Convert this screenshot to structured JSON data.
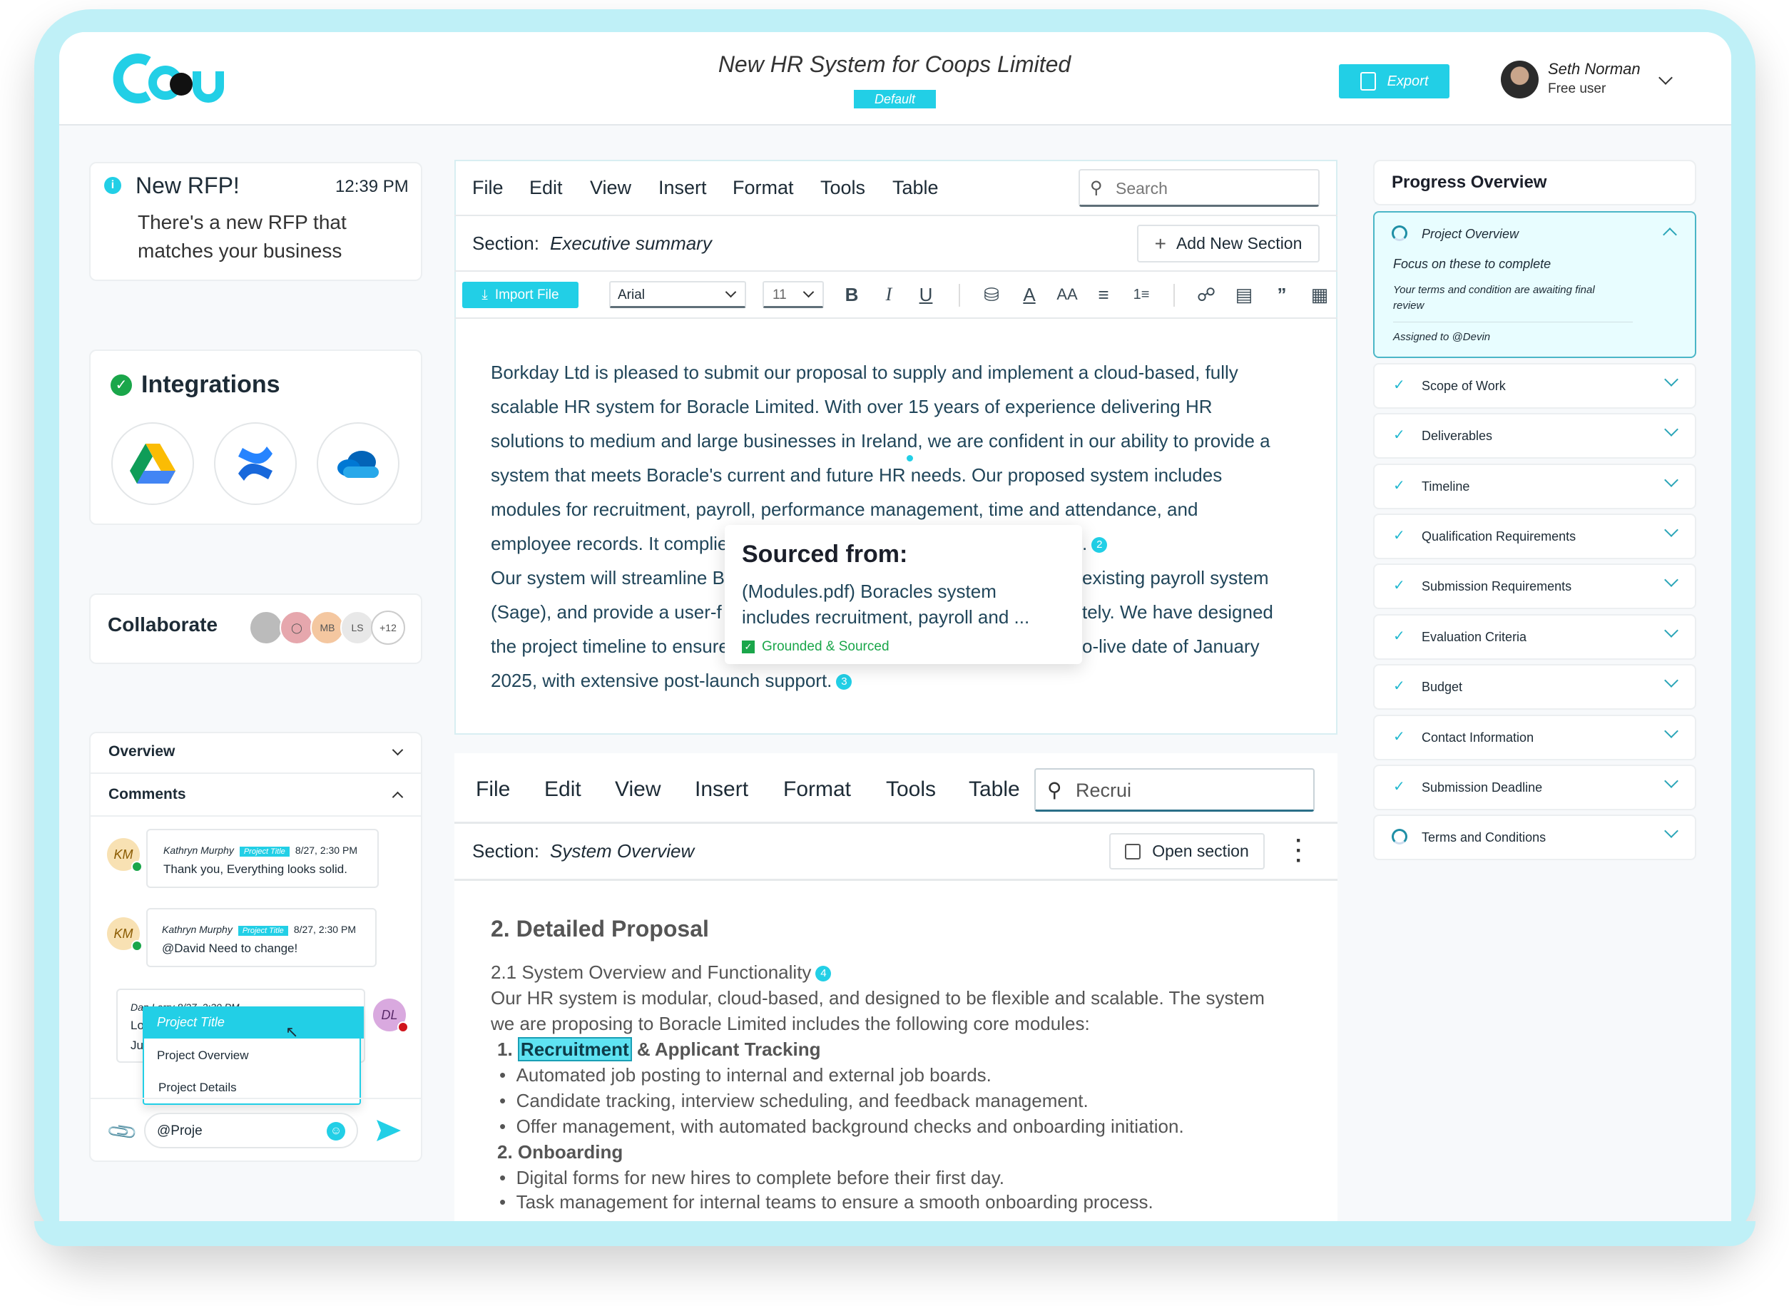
{
  "header": {
    "title": "New HR System for Coops Limited",
    "badge": "Default",
    "export_label": "Export",
    "user_name": "Seth Norman",
    "user_plan": "Free user"
  },
  "notification": {
    "title": "New RFP!",
    "time": "12:39 PM",
    "message_line1": "There's a new RFP that",
    "message_line2": "matches your business"
  },
  "integrations": {
    "title": "Integrations",
    "items": [
      "google-drive",
      "confluence",
      "onedrive"
    ]
  },
  "collaborate": {
    "title": "Collaborate",
    "avatars": [
      "MB",
      "LS",
      "+12"
    ]
  },
  "sidebar": {
    "overview_label": "Overview",
    "comments_label": "Comments"
  },
  "comments": [
    {
      "initials": "KM",
      "author": "Kathryn Murphy",
      "tag": "Project Title",
      "time": "8/27, 2:30 PM",
      "text": "Thank you, Everything looks solid."
    },
    {
      "initials": "KM",
      "author": "Kathryn Murphy",
      "tag": "Project Title",
      "time": "8/27, 2:30 PM",
      "text": "@David Need to change!"
    },
    {
      "initials": "DL",
      "author_partial": "Dan Larry  8/27, 2:30 PM",
      "line2": "Lo",
      "line3": "Ju"
    }
  ],
  "mention_dropdown": {
    "options": [
      "Project Title",
      "Project Overview",
      "Project Details"
    ],
    "selected": "Project Title"
  },
  "comment_input": {
    "value": "@Proje"
  },
  "editor1": {
    "menu": [
      "File",
      "Edit",
      "View",
      "Insert",
      "Format",
      "Tools",
      "Table"
    ],
    "search_placeholder": "Search",
    "section_label": "Section:",
    "section_name": "Executive summary",
    "add_section_label": "Add New Section",
    "import_label": "Import File",
    "font": "Arial",
    "font_size": "11",
    "lines": [
      "Borkday Ltd is pleased to submit our proposal to supply and implement a cloud-based, fully",
      "scalable HR system for Boracle Limited. With over 15 years of experience delivering HR",
      "solutions to medium and large businesses in Ireland, we are confident in our ability to provide a",
      "system that meets Boracle's current and future HR needs. Our proposed system includes",
      "modules for recruitment, payroll, performance management, time and attendance, and"
    ],
    "occluded_lines": [
      {
        "left": "employee records. It complie",
        "right": "."
      },
      {
        "left": "Our system will streamline B",
        "right": "existing payroll system"
      },
      {
        "left": "(Sage), and provide a user-f",
        "right": "tely. We have designed"
      },
      {
        "left": "the project timeline to ensure",
        "right": "o-live date of January"
      }
    ],
    "last_line": "2025, with extensive post-launch support.",
    "citation_2": "2",
    "citation_3": "3",
    "popup": {
      "title": "Sourced from:",
      "line1": "(Modules.pdf) Boracles system",
      "line2": "includes recruitment, payroll and ...",
      "status": "Grounded & Sourced"
    }
  },
  "editor2": {
    "menu": [
      "File",
      "Edit",
      "View",
      "Insert",
      "Format",
      "Tools",
      "Table"
    ],
    "search_value": "Recrui",
    "section_label": "Section:",
    "section_name": "System Overview",
    "open_section_label": "Open section",
    "heading": "2. Detailed Proposal",
    "subheading": "2.1 System Overview and Functionality",
    "citation_4": "4",
    "intro_line1": "Our HR system is modular, cloud-based, and designed to be flexible and scalable. The system",
    "intro_line2": "we are proposing to Boracle Limited includes the following core modules:",
    "item1_num": "1.",
    "item1_highlight": "Recruitment",
    "item1_rest": "& Applicant Tracking",
    "item1_bullets": [
      "Automated job posting to internal and external job boards.",
      "Candidate tracking, interview scheduling, and feedback management.",
      "Offer management, with automated background checks and onboarding initiation."
    ],
    "item2_num": "2.",
    "item2_title": "Onboarding",
    "item2_bullets": [
      "Digital forms for new hires to complete before their first day.",
      "Task management for internal teams to ensure a smooth onboarding process."
    ]
  },
  "progress": {
    "title": "Progress Overview",
    "active": {
      "label": "Project Overview",
      "focus": "Focus on these to complete",
      "note": "Your terms and condition are awaiting final review",
      "assigned": "Assigned to @Devin"
    },
    "items": [
      {
        "label": "Scope of Work",
        "status": "complete"
      },
      {
        "label": "Deliverables",
        "status": "complete"
      },
      {
        "label": "Timeline",
        "status": "complete"
      },
      {
        "label": "Qualification Requirements",
        "status": "complete"
      },
      {
        "label": "Submission Requirements",
        "status": "complete"
      },
      {
        "label": "Evaluation Criteria",
        "status": "complete"
      },
      {
        "label": "Budget",
        "status": "complete"
      },
      {
        "label": "Contact Information",
        "status": "complete"
      },
      {
        "label": "Submission Deadline",
        "status": "complete"
      },
      {
        "label": "Terms and Conditions",
        "status": "in-progress"
      }
    ]
  },
  "colors": {
    "accent": "#22cfe6",
    "text_dark": "#1d2b36",
    "body_text": "#21465a",
    "success": "#1aa64a"
  }
}
